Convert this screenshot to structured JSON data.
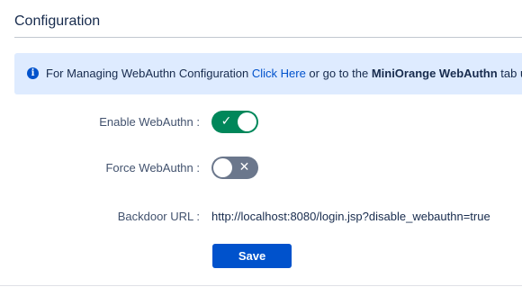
{
  "section": {
    "title": "Configuration"
  },
  "info_banner": {
    "icon": "info-icon",
    "text_before": "For Managing WebAuthn Configuration ",
    "link_label": "Click Here",
    "text_middle": " or go to the ",
    "tab_name": "MiniOrange WebAuthn",
    "text_after": " tab under",
    "colors": {
      "background": "#deebff",
      "link": "#0052cc"
    }
  },
  "form": {
    "enable_webauthn": {
      "label": "Enable WebAuthn :",
      "state": "on",
      "glyph": "✓",
      "color": "#00875a"
    },
    "force_webauthn": {
      "label": "Force WebAuthn :",
      "state": "off",
      "glyph": "✕",
      "color": "#6b778c"
    },
    "backdoor_url": {
      "label": "Backdoor URL :",
      "value": "http://localhost:8080/login.jsp?disable_webauthn=true"
    },
    "save_label": "Save",
    "save_color": "#0052cc"
  }
}
